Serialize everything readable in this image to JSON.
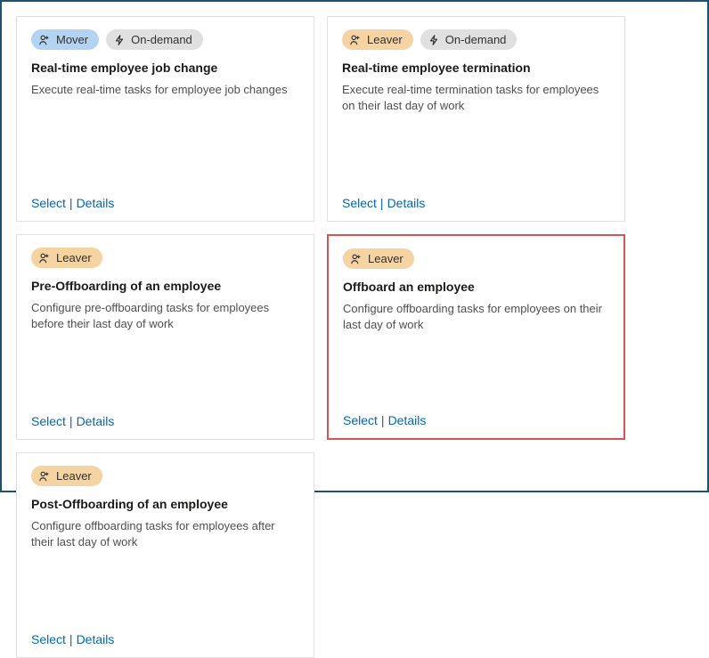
{
  "labels": {
    "select": "Select",
    "details": "Details"
  },
  "badges": {
    "mover": "Mover",
    "leaver": "Leaver",
    "ondemand": "On-demand"
  },
  "cards": [
    {
      "badges": [
        "mover",
        "ondemand"
      ],
      "title": "Real-time employee job change",
      "desc": "Execute real-time tasks for employee job changes",
      "highlighted": false
    },
    {
      "badges": [
        "leaver",
        "ondemand"
      ],
      "title": "Real-time employee termination",
      "desc": "Execute real-time termination tasks for employees on their last day of work",
      "highlighted": false
    },
    {
      "badges": [
        "leaver"
      ],
      "title": "Pre-Offboarding of an employee",
      "desc": "Configure pre-offboarding tasks for employees before their last day of work",
      "highlighted": false
    },
    {
      "badges": [
        "leaver"
      ],
      "title": "Offboard an employee",
      "desc": "Configure offboarding tasks for employees on their last day of work",
      "highlighted": true
    },
    {
      "badges": [
        "leaver"
      ],
      "title": "Post-Offboarding of an employee",
      "desc": "Configure offboarding tasks for employees after their last day of work",
      "highlighted": false
    }
  ]
}
